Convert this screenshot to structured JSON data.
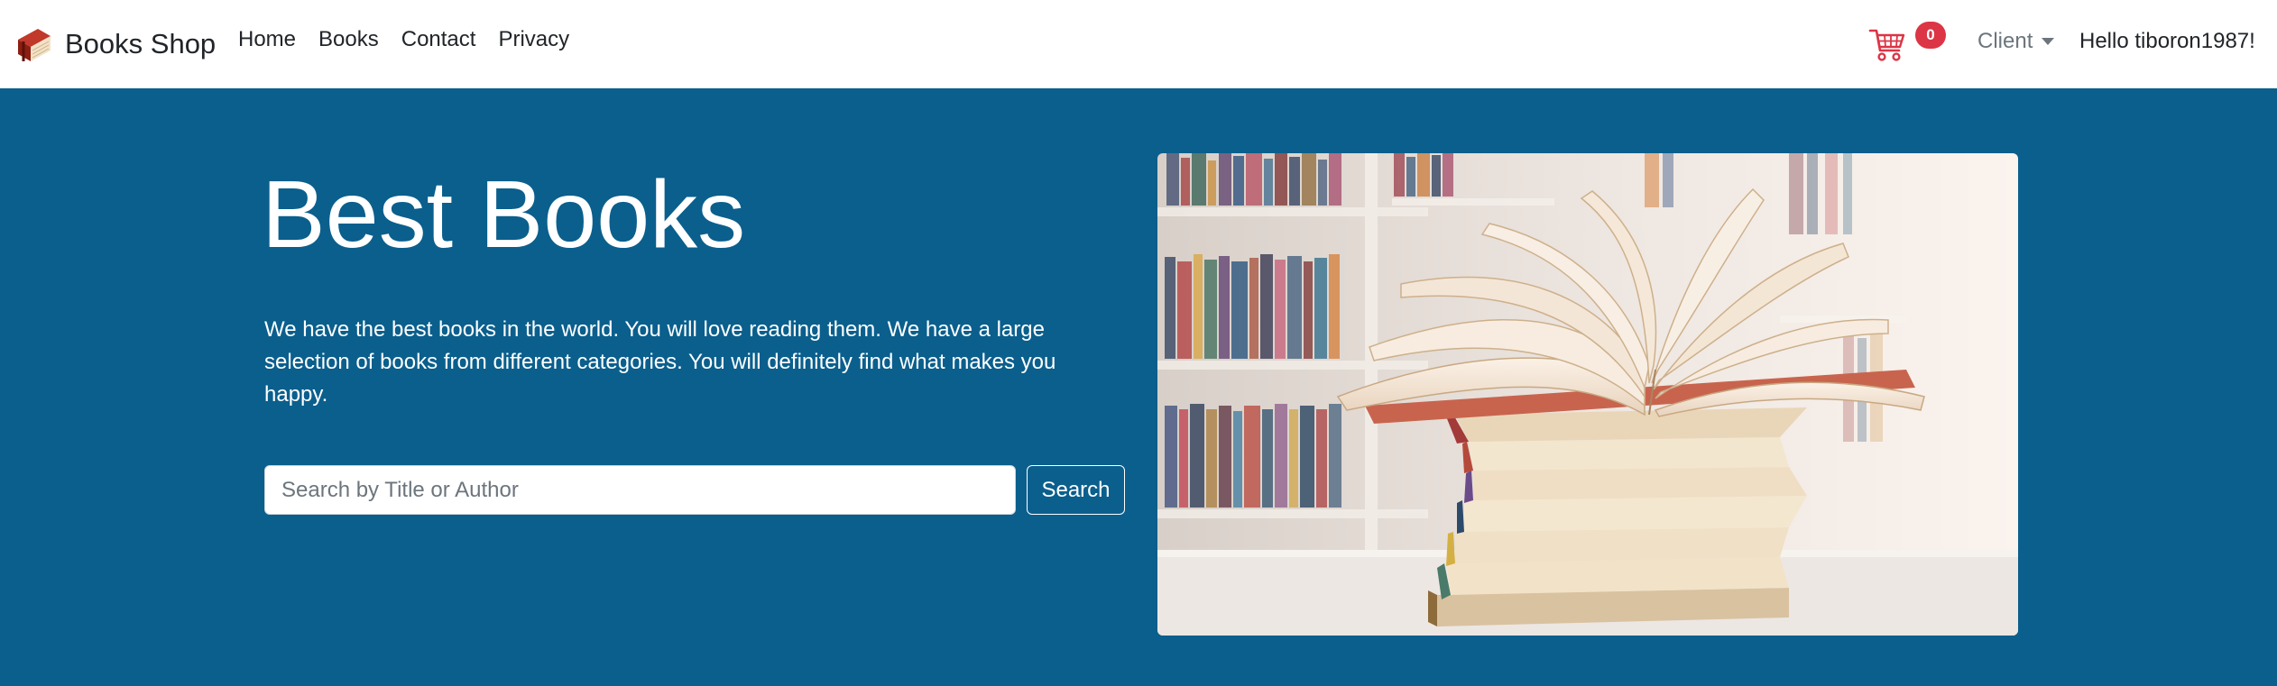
{
  "brand": {
    "name": "Books Shop",
    "logo_icon": "book-icon"
  },
  "nav": {
    "links": [
      {
        "label": "Home"
      },
      {
        "label": "Books"
      },
      {
        "label": "Contact"
      },
      {
        "label": "Privacy"
      }
    ]
  },
  "cart": {
    "icon": "shopping-cart-icon",
    "count": "0",
    "badge_color": "#dc3545"
  },
  "user_menu": {
    "label": "Client",
    "greeting": "Hello tiboron1987!"
  },
  "hero": {
    "title": "Best Books",
    "description": "We have the best books in the world. You will love reading them. We have a large selection of books from different categories. You will definitely find what makes you happy.",
    "search": {
      "placeholder": "Search by Title or Author",
      "value": "",
      "button_label": "Search"
    },
    "background_color": "#0a5f8d",
    "image": "open-books-on-stack-library-photo"
  },
  "colors": {
    "accent_cart": "#dc3545",
    "hero_bg": "#0a5f8d"
  }
}
